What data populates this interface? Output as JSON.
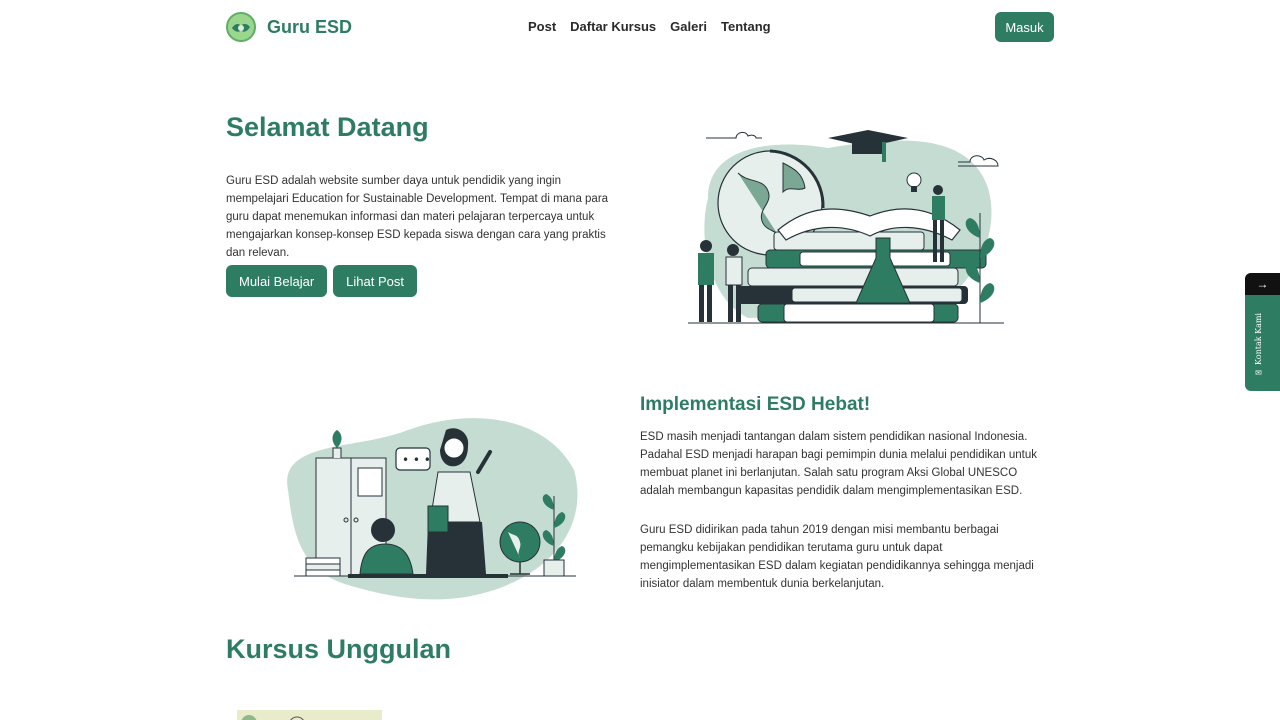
{
  "navbar": {
    "brand": "Guru ESD",
    "links": [
      "Post",
      "Daftar Kursus",
      "Galeri",
      "Tentang"
    ],
    "login_label": "Masuk"
  },
  "hero": {
    "title": "Selamat Datang",
    "description": "Guru ESD adalah website sumber daya untuk pendidik yang ingin mempelajari Education for Sustainable Development. Tempat di mana para guru dapat menemukan informasi dan materi pelajaran terpercaya untuk mengajarkan konsep-konsep ESD kepada siswa dengan cara yang praktis dan relevan.",
    "primary_button": "Mulai Belajar",
    "secondary_button": "Lihat Post"
  },
  "about": {
    "title": "Implementasi ESD Hebat!",
    "paragraph1": "ESD masih menjadi tantangan dalam sistem pendidikan nasional Indonesia. Padahal ESD menjadi harapan bagi pemimpin dunia melalui pendidikan untuk membuat planet ini berlanjutan. Salah satu program Aksi Global UNESCO adalah membangun kapasitas pendidik dalam mengimplementasikan ESD.",
    "paragraph2": "Guru ESD didirikan pada tahun 2019 dengan misi membantu berbagai pemangku kebijakan pendidikan terutama guru untuk dapat mengimplementasikan ESD dalam kegiatan pendidikannya sehingga menjadi inisiator dalam membentuk dunia berkelanjutan."
  },
  "courses": {
    "title": "Kursus Unggulan"
  },
  "side_tab": {
    "arrow": "→",
    "label": "✉ Kontak Kami"
  },
  "colors": {
    "primary": "#2e7d62",
    "illustration_bg": "#c5dcd3",
    "dark": "#263238"
  },
  "icons": {
    "logo": "globe-leaf-logo",
    "hero_illustration": "students-books-globe-illustration",
    "about_illustration": "teacher-student-classroom-illustration"
  }
}
